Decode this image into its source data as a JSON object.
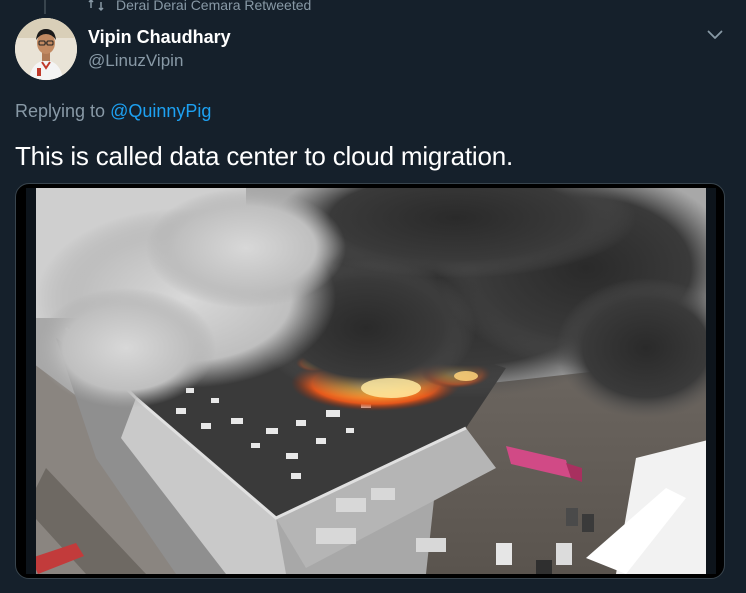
{
  "retweet": {
    "text": "Derai Derai Cemara Retweeted",
    "icon": "retweet-icon"
  },
  "author": {
    "name": "Vipin Chaudhary",
    "handle": "@LinuzVipin",
    "avatar_icon": "avatar"
  },
  "menu": {
    "icon": "chevron-down-icon"
  },
  "reply": {
    "prefix": "Replying to ",
    "handle": "@QuinnyPig"
  },
  "tweet": {
    "text": "This is called data center to cloud migration."
  },
  "media": {
    "description_icon": "photo-building-fire"
  },
  "colors": {
    "background": "#15202b",
    "secondary_text": "#8899a6",
    "link": "#1da1f2",
    "border": "#38444d"
  }
}
